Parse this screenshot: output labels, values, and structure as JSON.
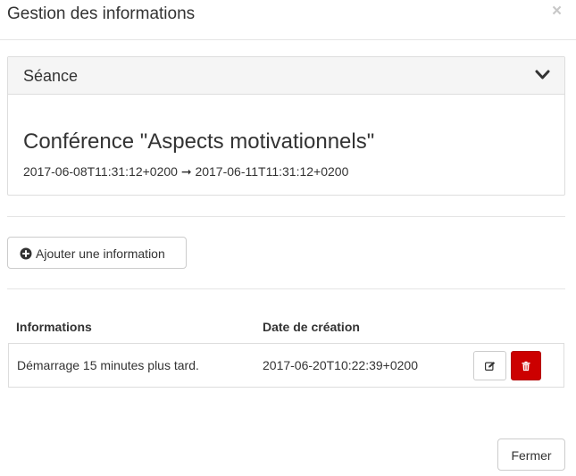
{
  "modal": {
    "title": "Gestion des informations",
    "close_symbol": "×"
  },
  "session_panel": {
    "heading": "Séance",
    "event_title": "Conférence \"Aspects motivationnels\"",
    "dates": "2017-06-08T11:31:12+0200 ➞ 2017-06-11T11:31:12+0200"
  },
  "actions": {
    "add_label": "Ajouter une information"
  },
  "table": {
    "headers": [
      "Informations",
      "Date de création"
    ],
    "rows": [
      {
        "information": "Démarrage 15 minutes plus tard.",
        "created": "2017-06-20T10:22:39+0200"
      }
    ]
  },
  "footer": {
    "close_label": "Fermer"
  },
  "icons": {
    "chevron": "chevron-down-icon",
    "add": "plus-circle-icon",
    "edit": "edit-icon",
    "delete": "trash-icon"
  },
  "colors": {
    "danger": "#cc0000",
    "border": "#dddddd",
    "panel_heading_bg": "#f5f5f5"
  }
}
